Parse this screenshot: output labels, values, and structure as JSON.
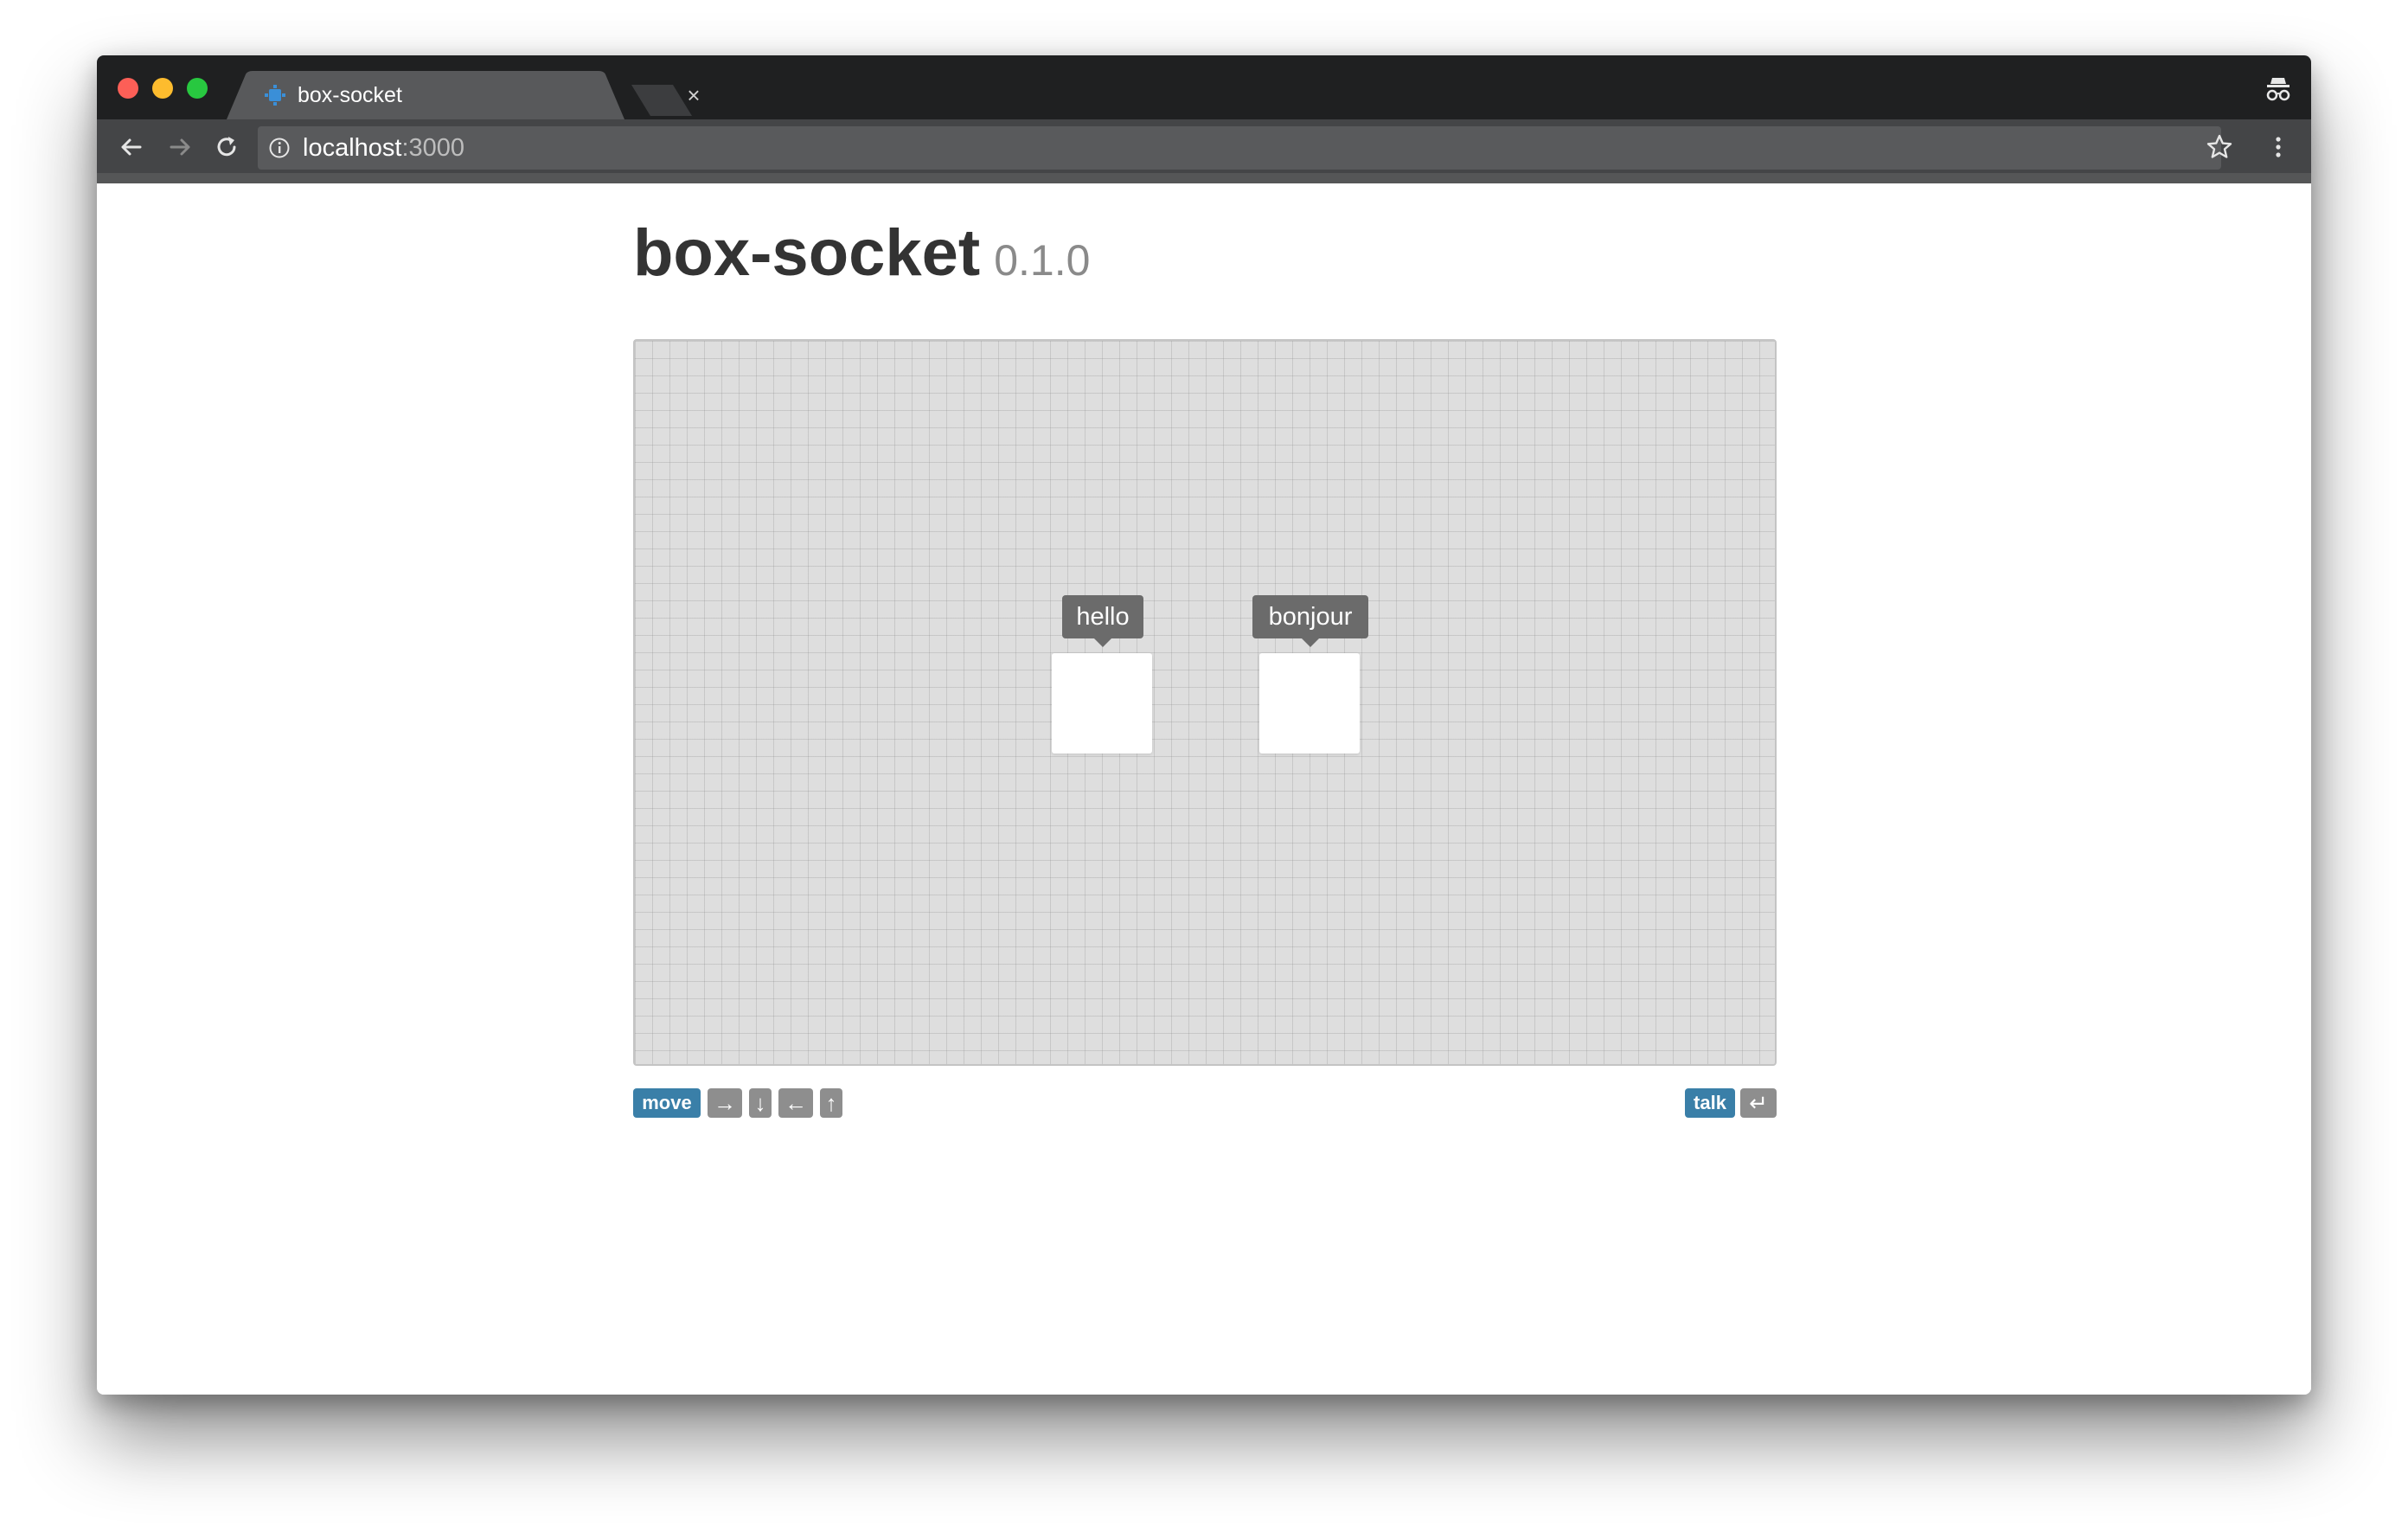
{
  "browser": {
    "tab": {
      "title": "box-socket",
      "close_glyph": "×",
      "favicon": "box-socket-favicon"
    },
    "address_bar": {
      "host": "localhost",
      "port": ":3000"
    },
    "icons": {
      "back": "back-arrow-icon",
      "forward": "forward-arrow-icon",
      "reload": "reload-icon",
      "info": "info-icon",
      "bookmark": "star-icon",
      "menu": "kebab-menu-icon",
      "incognito": "incognito-icon"
    }
  },
  "page": {
    "title": "box-socket",
    "version": "0.1.0"
  },
  "board": {
    "players": [
      {
        "speech": "hello"
      },
      {
        "speech": "bonjour"
      }
    ]
  },
  "controls": {
    "move": {
      "label": "move",
      "keys": [
        "→",
        "↓",
        "←",
        "↑"
      ]
    },
    "talk": {
      "label": "talk",
      "key": "↵"
    }
  },
  "colors": {
    "accent": "#3a7fa8",
    "key_badge": "#8e8e8e",
    "bubble": "#6b6b6b",
    "board": "#dedede"
  }
}
